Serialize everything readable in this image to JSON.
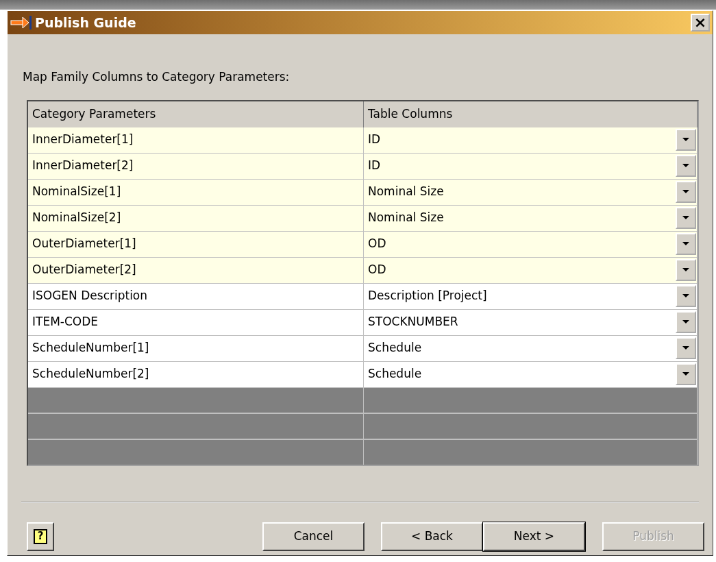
{
  "window": {
    "title": "Publish Guide",
    "close": "×"
  },
  "instruction": "Map Family Columns to Category Parameters:",
  "table": {
    "columns": [
      "Category Parameters",
      "Table Columns"
    ],
    "rows": [
      {
        "parameter": "InnerDiameter[1]",
        "column": "ID",
        "highlighted": true
      },
      {
        "parameter": "InnerDiameter[2]",
        "column": "ID",
        "highlighted": true
      },
      {
        "parameter": "NominalSize[1]",
        "column": "Nominal Size",
        "highlighted": true
      },
      {
        "parameter": "NominalSize[2]",
        "column": "Nominal Size",
        "highlighted": true
      },
      {
        "parameter": "OuterDiameter[1]",
        "column": "OD",
        "highlighted": true
      },
      {
        "parameter": "OuterDiameter[2]",
        "column": "OD",
        "highlighted": true
      },
      {
        "parameter": "ISOGEN Description",
        "column": "Description [Project]",
        "highlighted": false
      },
      {
        "parameter": "ITEM-CODE",
        "column": "STOCKNUMBER",
        "highlighted": false
      },
      {
        "parameter": "ScheduleNumber[1]",
        "column": "Schedule",
        "highlighted": false
      },
      {
        "parameter": "ScheduleNumber[2]",
        "column": "Schedule",
        "highlighted": false
      }
    ]
  },
  "help": "?",
  "buttons": [
    {
      "label": "Cancel",
      "kind": "normal",
      "disabled": false
    },
    {
      "label": "< Back",
      "kind": "normal",
      "disabled": false
    },
    {
      "label": "Next >",
      "kind": "default",
      "disabled": false
    },
    {
      "label": "Publish",
      "kind": "normal",
      "disabled": true
    }
  ]
}
